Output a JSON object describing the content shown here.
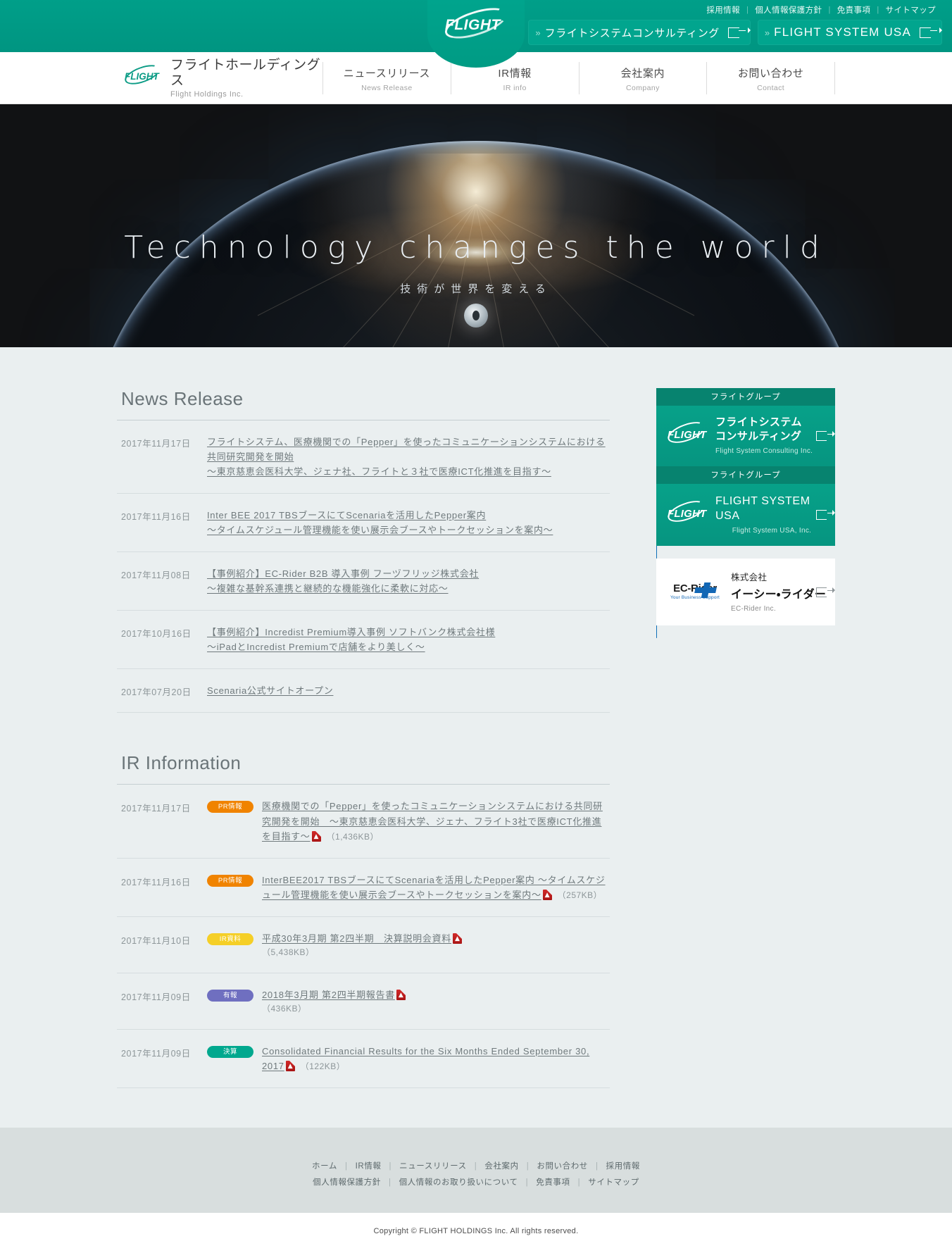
{
  "topbar": {
    "util_links": [
      "採用情報",
      "個人情報保護方針",
      "免責事項",
      "サイトマップ"
    ],
    "group_buttons": [
      {
        "label": "フライトシステムコンサルティング",
        "chevron": "»"
      },
      {
        "label": "FLIGHT SYSTEM USA",
        "chevron": "»"
      }
    ],
    "logo_word": "FLIGHT"
  },
  "nav": {
    "brand": {
      "ja": "フライトホールディングス",
      "en": "Flight Holdings Inc.",
      "mark": "FLIGHT"
    },
    "items": [
      {
        "ja": "ニュースリリース",
        "en": "News Release"
      },
      {
        "ja": "IR情報",
        "en": "IR info"
      },
      {
        "ja": "会社案内",
        "en": "Company"
      },
      {
        "ja": "お問い合わせ",
        "en": "Contact"
      }
    ]
  },
  "hero": {
    "headline": "Technology changes the world",
    "subline": "技術が世界を変える"
  },
  "news": {
    "title": "News Release",
    "items": [
      {
        "date": "2017年11月17日",
        "title": "フライトシステム、医療機関での「Pepper」を使ったコミュニケーションシステムにおける共同研究開発を開始\n～東京慈恵会医科大学、ジェナ社、フライトと３社で医療ICT化推進を目指す～"
      },
      {
        "date": "2017年11月16日",
        "title": "Inter BEE 2017 TBSブースにてScenariaを活用したPepper案内\n～タイムスケジュール管理機能を使い展示会ブースやトークセッションを案内～"
      },
      {
        "date": "2017年11月08日",
        "title": "【事例紹介】EC-Rider B2B 導入事例 フーヅフリッジ株式会社\n～複雑な基幹系連携と継続的な機能強化に柔軟に対応～"
      },
      {
        "date": "2017年10月16日",
        "title": "【事例紹介】Incredist Premium導入事例 ソフトバンク株式会社様\n～iPadとIncredist Premiumで店舗をより美しく～"
      },
      {
        "date": "2017年07月20日",
        "title": "Scenaria公式サイトオープン"
      }
    ]
  },
  "ir": {
    "title": "IR Information",
    "items": [
      {
        "date": "2017年11月17日",
        "badge": "PR情報",
        "badge_color": "#f08300",
        "title": "医療機関での「Pepper」を使ったコミュニケーションシステムにおける共同研究開発を開始　～東京慈恵会医科大学、ジェナ、フライト3社で医療ICT化推進を目指す～",
        "size": "（1,436KB）",
        "has_pdf": true
      },
      {
        "date": "2017年11月16日",
        "badge": "PR情報",
        "badge_color": "#f08300",
        "title": "InterBEE2017 TBSブースにてScenariaを活用したPepper案内 ～タイムスケジュール管理機能を使い展示会ブースやトークセッションを案内～",
        "size": "（257KB）",
        "has_pdf": true
      },
      {
        "date": "2017年11月10日",
        "badge": "IR資料",
        "badge_color": "#f5cf27",
        "title": "平成30年3月期 第2四半期　決算説明会資料",
        "size": "（5,438KB）",
        "has_pdf": true
      },
      {
        "date": "2017年11月09日",
        "badge": "有報",
        "badge_color": "#6f6fc0",
        "title": "2018年3月期 第2四半期報告書",
        "size": "（436KB）",
        "has_pdf": true
      },
      {
        "date": "2017年11月09日",
        "badge": "決算",
        "badge_color": "#00a88e",
        "title": "Consolidated Financial Results for the Six Months Ended September 30, 2017",
        "size": "（122KB）",
        "has_pdf": true
      }
    ]
  },
  "sidebar": {
    "banners": [
      {
        "head": "フライトグループ",
        "mark": "FLIGHT",
        "ja": "フライトシステム\nコンサルティング",
        "en": "Flight System Consulting Inc."
      },
      {
        "head": "フライトグループ",
        "mark": "FLIGHT",
        "ja": "FLIGHT SYSTEM USA",
        "en": "Flight System USA, Inc."
      }
    ],
    "ecrider": {
      "mark_name": "EC-Rider",
      "mark_tag": "Your Business Support",
      "company": "株式会社",
      "name": "イーシー・ライダー",
      "en": "EC-Rider Inc."
    }
  },
  "footer": {
    "row1": [
      "ホーム",
      "IR情報",
      "ニュースリリース",
      "会社案内",
      "お問い合わせ",
      "採用情報"
    ],
    "row2": [
      "個人情報保護方針",
      "個人情報のお取り扱いについて",
      "免責事項",
      "サイトマップ"
    ],
    "copyright": "Copyright © FLIGHT HOLDINGS Inc. All rights reserved."
  }
}
